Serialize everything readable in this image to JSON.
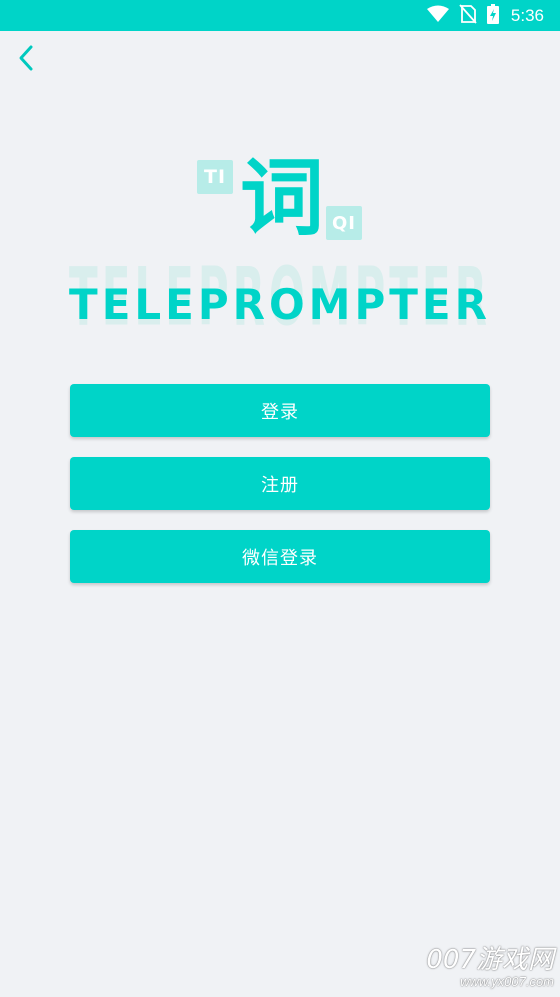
{
  "status_bar": {
    "time": "5:36",
    "icons": [
      "wifi-icon",
      "no-sim-icon",
      "battery-charging-icon"
    ],
    "background": "#00d4c8"
  },
  "nav": {
    "back_icon": "chevron-left-icon"
  },
  "logo": {
    "char": "词",
    "ti": "TI",
    "qi": "QI",
    "wordmark": "TELEPROMPTER"
  },
  "buttons": {
    "login": "登录",
    "register": "注册",
    "wechat_login": "微信登录"
  },
  "watermark": {
    "main": "007游戏网",
    "url": "www.yx007.com"
  },
  "colors": {
    "accent": "#00d4c8",
    "accent_light": "#b7ece8",
    "background": "#f0f2f5"
  }
}
